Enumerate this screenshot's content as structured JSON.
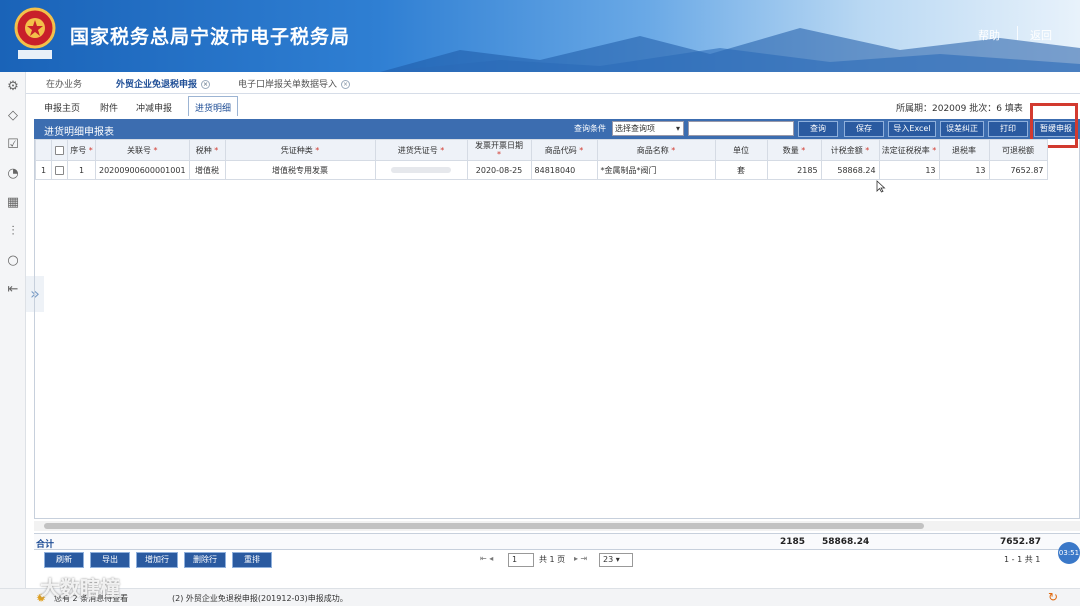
{
  "header": {
    "title": "国家税务总局宁波市电子税务局",
    "emblem_text": "中国税务",
    "help": "帮助",
    "back": "返回"
  },
  "tabs_top": [
    {
      "label": "在办业务"
    },
    {
      "label": "外贸企业免退税申报"
    },
    {
      "label": "电子口岸报关单数据导入"
    }
  ],
  "tabs_sub": [
    {
      "label": "申报主页"
    },
    {
      "label": "附件"
    },
    {
      "label": "冲减申报"
    },
    {
      "label": "进货明细"
    }
  ],
  "period": {
    "text": "所属期：202009  批次：6  填表"
  },
  "section": {
    "title": "进货明细申报表",
    "query_label": "查询条件",
    "query_select": "选择查询项",
    "buttons": {
      "query": "查询",
      "save": "保存",
      "import_excel": "导入Excel",
      "error_fix": "误差纠正",
      "print": "打印",
      "temp_save": "暂缓申报"
    }
  },
  "columns": [
    {
      "label": "",
      "req": false
    },
    {
      "label": "序号",
      "req": true
    },
    {
      "label": "关联号",
      "req": true
    },
    {
      "label": "税种",
      "req": true
    },
    {
      "label": "凭证种类",
      "req": true
    },
    {
      "label": "进货凭证号",
      "req": true
    },
    {
      "label": "发票开票日期",
      "req": true
    },
    {
      "label": "商品代码",
      "req": true
    },
    {
      "label": "商品名称",
      "req": true
    },
    {
      "label": "单位",
      "req": false
    },
    {
      "label": "数量",
      "req": true
    },
    {
      "label": "计税金额",
      "req": true
    },
    {
      "label": "法定征税税率",
      "req": true
    },
    {
      "label": "退税率",
      "req": false
    },
    {
      "label": "可退税额",
      "req": false
    }
  ],
  "rows": [
    {
      "idx": "1",
      "seq": "1",
      "ref": "20200900600001001",
      "tax": "增值税",
      "voucher_type": "增值税专用发票",
      "voucher_no": "",
      "invoice_date": "2020-08-25",
      "code": "84818040",
      "name": "*金属制品*阀门",
      "unit": "套",
      "qty": "2185",
      "amount": "58868.24",
      "legal_rate": "13",
      "refund_rate": "13",
      "refundable": "7652.87"
    }
  ],
  "totals": {
    "label": "合计",
    "qty": "2185",
    "amount": "58868.24",
    "refundable": "7652.87"
  },
  "bottom_buttons": {
    "refresh": "刷新",
    "export": "导出",
    "add_row": "增加行",
    "delete_row": "删除行",
    "reset": "重排"
  },
  "pager": {
    "page": "1",
    "total_label": "共 1 页",
    "page_size": "23",
    "range": "1 - 1  共 1"
  },
  "status": {
    "left": "您有 2 条消息待查看",
    "msg": "(2)  外贸企业免退税申报(201912-03)申报成功。",
    "clock": "03:51"
  },
  "watermark": "大数瞎橦",
  "colors": {
    "brand_blue": "#3c6db0",
    "highlight_red": "#d23a2f",
    "button_blue": "#2a5aa0"
  }
}
